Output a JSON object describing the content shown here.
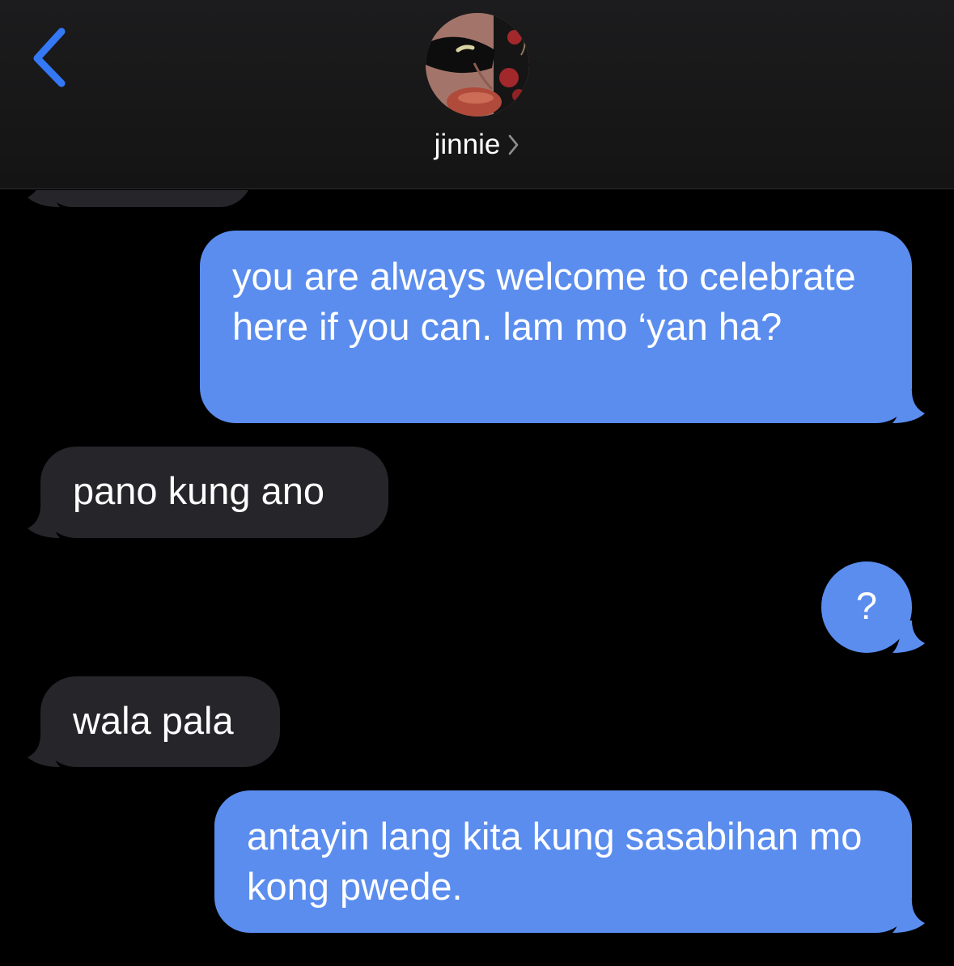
{
  "header": {
    "contact_name": "jinnie",
    "back_icon": "chevron-left-icon",
    "detail_icon": "chevron-right-icon",
    "accent_color": "#3478f6"
  },
  "messages": [
    {
      "direction": "received",
      "text": ""
    },
    {
      "direction": "sent",
      "text": "you are always welcome to celebrate here if you can. lam mo ‘yan ha?"
    },
    {
      "direction": "received",
      "text": "pano kung ano"
    },
    {
      "direction": "sent",
      "text": "?"
    },
    {
      "direction": "received",
      "text": "wala pala"
    },
    {
      "direction": "sent",
      "text": "antayin lang kita kung sasabihan mo kong pwede."
    }
  ],
  "colors": {
    "sent_bubble": "#5b8def",
    "received_bubble": "#26252a",
    "background": "#000000",
    "header_background": "#1c1c1e"
  }
}
